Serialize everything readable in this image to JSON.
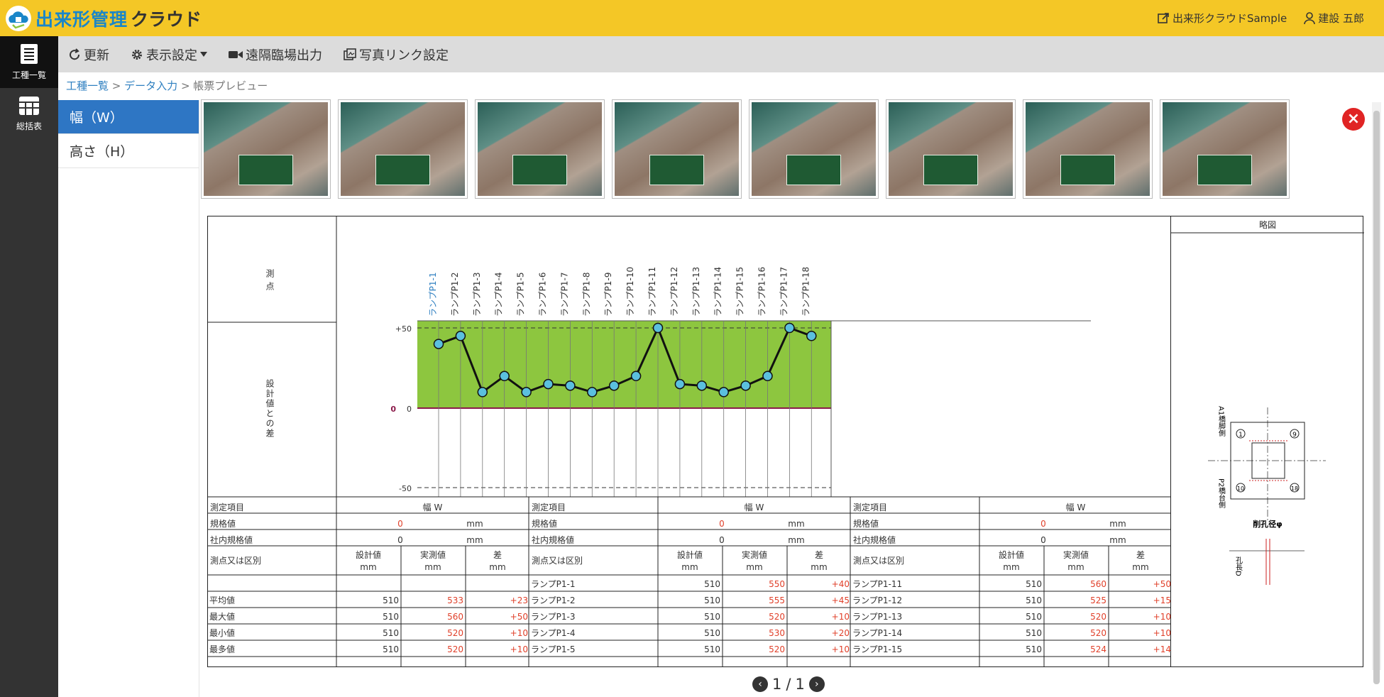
{
  "app": {
    "logo_text": "出来形管理",
    "logo_suffix": "クラウド"
  },
  "header": {
    "project": "出来形クラウドSample",
    "user": "建設 五郎"
  },
  "rail": [
    {
      "label": "工種一覧",
      "active": true
    },
    {
      "label": "総括表",
      "active": false
    }
  ],
  "toolbar": {
    "refresh": "更新",
    "display": "表示設定",
    "remote": "遠隔臨場出力",
    "photo_link": "写真リンク設定"
  },
  "breadcrumb": {
    "item1": "工種一覧",
    "item2": "データ入力",
    "item3": "帳票プレビュー"
  },
  "tabs": [
    {
      "label": "幅（W）",
      "active": true
    },
    {
      "label": "高さ（H）",
      "active": false
    }
  ],
  "photos": 8,
  "pager": {
    "current": "1",
    "separator": "/",
    "total": "1"
  },
  "report": {
    "measure_points_label": "測点",
    "diff_label": "設計値との差",
    "diagram_title": "略図",
    "diagram_labels": {
      "a1": "A1橋脚側",
      "p2": "P2橋台側",
      "bore": "削孔径φ",
      "depth": "孔長D"
    },
    "diagram_points": [
      "1",
      "9",
      "10",
      "18"
    ],
    "table": {
      "item_label": "測定項目",
      "item_value": "幅 W",
      "spec_label": "規格値",
      "internal_label": "社内規格値",
      "spec_value": "0",
      "unit": "mm",
      "point_label": "測点又は区別",
      "col_design": "設計値",
      "col_actual": "実測値",
      "col_diff": "差",
      "stats": [
        {
          "label": "平均値",
          "design": "510",
          "actual": "533",
          "diff": "+23"
        },
        {
          "label": "最大値",
          "design": "510",
          "actual": "560",
          "diff": "+50"
        },
        {
          "label": "最小値",
          "design": "510",
          "actual": "520",
          "diff": "+10"
        },
        {
          "label": "最多値",
          "design": "510",
          "actual": "520",
          "diff": "+10"
        }
      ],
      "rows_mid": [
        {
          "name": "ランプP1-1",
          "design": "510",
          "actual": "550",
          "diff": "+40"
        },
        {
          "name": "ランプP1-2",
          "design": "510",
          "actual": "555",
          "diff": "+45"
        },
        {
          "name": "ランプP1-3",
          "design": "510",
          "actual": "520",
          "diff": "+10"
        },
        {
          "name": "ランプP1-4",
          "design": "510",
          "actual": "530",
          "diff": "+20"
        },
        {
          "name": "ランプP1-5",
          "design": "510",
          "actual": "520",
          "diff": "+10"
        }
      ],
      "rows_right": [
        {
          "name": "ランプP1-11",
          "design": "510",
          "actual": "560",
          "diff": "+50"
        },
        {
          "name": "ランプP1-12",
          "design": "510",
          "actual": "525",
          "diff": "+15"
        },
        {
          "name": "ランプP1-13",
          "design": "510",
          "actual": "520",
          "diff": "+10"
        },
        {
          "name": "ランプP1-14",
          "design": "510",
          "actual": "520",
          "diff": "+10"
        },
        {
          "name": "ランプP1-15",
          "design": "510",
          "actual": "524",
          "diff": "+14"
        }
      ]
    }
  },
  "chart_data": {
    "type": "line",
    "categories": [
      "ランプP1-1",
      "ランプP1-2",
      "ランプP1-3",
      "ランプP1-4",
      "ランプP1-5",
      "ランプP1-6",
      "ランプP1-7",
      "ランプP1-8",
      "ランプP1-9",
      "ランプP1-10",
      "ランプP1-11",
      "ランプP1-12",
      "ランプP1-13",
      "ランプP1-14",
      "ランプP1-15",
      "ランプP1-16",
      "ランプP1-17",
      "ランプP1-18"
    ],
    "values": [
      40,
      45,
      10,
      20,
      10,
      15,
      14,
      10,
      14,
      20,
      50,
      15,
      14,
      10,
      14,
      20,
      50,
      45
    ],
    "ylim": [
      -50,
      50
    ],
    "yticks": [
      "+50",
      "0",
      "-50"
    ],
    "zero_label": "0",
    "band": [
      0,
      50
    ],
    "colors": {
      "band": "#8dc63f",
      "line": "#111111",
      "point": "#5bc0de",
      "zero": "#8b1a4a",
      "highlight": "#2e7fc0"
    }
  }
}
